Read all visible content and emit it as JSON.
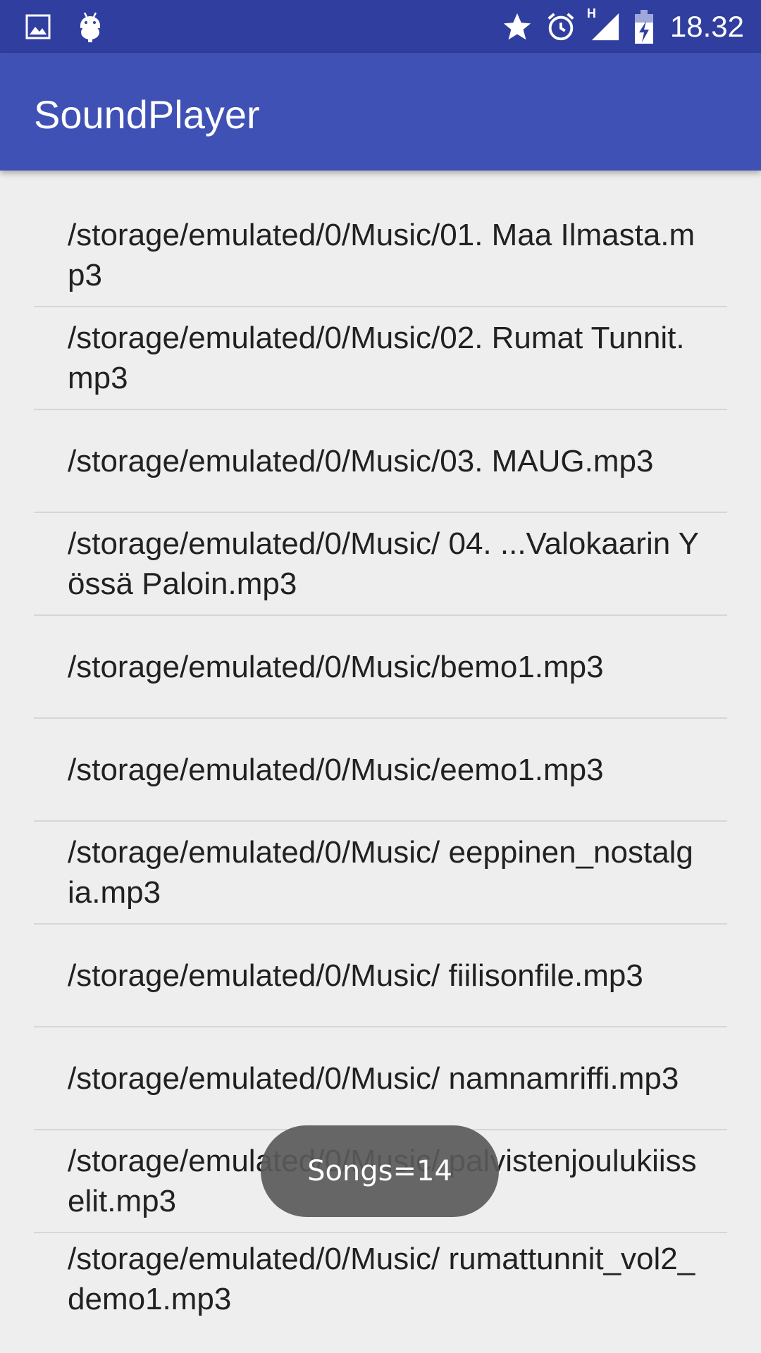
{
  "status_bar": {
    "time": "18.32",
    "network_label": "H"
  },
  "app_bar": {
    "title": "SoundPlayer"
  },
  "songs": [
    {
      "path": "/storage/emulated/0/Music/01. Maa Ilmasta.mp3"
    },
    {
      "path": "/storage/emulated/0/Music/02. Rumat Tunnit.mp3"
    },
    {
      "path": "/storage/emulated/0/Music/03. MAUG.mp3"
    },
    {
      "path": "/storage/emulated/0/Music/ 04. ...Valokaarin Yössä Paloin.mp3"
    },
    {
      "path": "/storage/emulated/0/Music/bemo1.mp3"
    },
    {
      "path": "/storage/emulated/0/Music/eemo1.mp3"
    },
    {
      "path": "/storage/emulated/0/Music/ eeppinen_nostalgia.mp3"
    },
    {
      "path": "/storage/emulated/0/Music/ fiilisonfile.mp3"
    },
    {
      "path": "/storage/emulated/0/Music/ namnamriffi.mp3"
    },
    {
      "path": "/storage/emulated/0/Music/ palvistenjoulukiisselit.mp3"
    },
    {
      "path": "/storage/emulated/0/Music/ rumattunnit_vol2_demo1.mp3"
    }
  ],
  "toast": {
    "text": "Songs=14"
  },
  "colors": {
    "status_bar": "#303f9f",
    "app_bar": "#3f51b5",
    "background": "#eeeeee"
  }
}
